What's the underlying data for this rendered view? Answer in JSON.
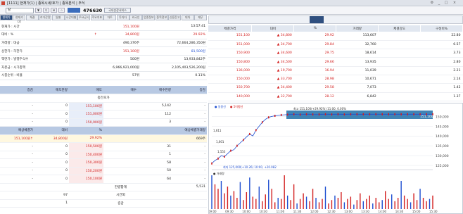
{
  "titlebar": {
    "title": "[1111] 현재가(1) | 종목시세/호가 | 종목분석 | 주식",
    "tabs": "현재가 | 종목시세 | 차트 | 기타"
  },
  "toolbar": {
    "code_value": "탈",
    "price_display": "476630",
    "service_label": "국내상장서비스",
    "btn_labels": [
      "▼",
      "⚲",
      "⊞",
      "☆"
    ]
  },
  "tabs": [
    "현재가(1)",
    "현재가(2)",
    "체결",
    "호가잔량",
    "일별",
    "시간대별",
    "주요공시",
    "주요지표",
    "차트",
    "투자자",
    "외국인",
    "업종정보",
    "종목정보",
    "신용잔고",
    "대차",
    "재무"
  ],
  "info_rows": [
    {
      "label": "현재가 : 시간",
      "v1": "151,100원",
      "v2": "13:57:41"
    },
    {
      "label": "대비 : %",
      "v1": "34,800원",
      "v2": "29.92%",
      "mark": "↑"
    },
    {
      "label": "거래량 : 대금",
      "v1": "490,376주",
      "v2": "72,664,286,350원"
    },
    {
      "label": "상한가 : 하한가",
      "v1": "151,100원",
      "v2": "81,500원"
    },
    {
      "label": "액면가 : 발행주식수",
      "v1": "500원",
      "v2": "13,933,842주"
    },
    {
      "label": "자본금 : 시가총액",
      "v1": "6,966,921,000원",
      "v2": "2,105,403,526,200원"
    },
    {
      "label": "시총순위 : 비율",
      "v1": "57위",
      "v2": "0.11%"
    }
  ],
  "orderbook": {
    "headers": [
      "증감",
      "매도잔량",
      "매도",
      "매수",
      "매수잔량",
      "증감"
    ],
    "middle_label": "중간호가",
    "asks": [
      {
        "dq": "-",
        "qty": "0",
        "price": "151,100원",
        "bq": "5,142",
        "bd": "-"
      },
      {
        "dq": "-",
        "qty": "0",
        "price": "151,000원",
        "bq": "112",
        "bd": "-"
      },
      {
        "dq": "-",
        "qty": "0",
        "price": "150,900원",
        "bq": "3",
        "bd": "-"
      }
    ],
    "expected_headers": [
      "예상체결가",
      "대비",
      "%",
      "예상체결거래량"
    ],
    "expected": {
      "price": "151,100원",
      "mark": "↑",
      "diff": "34,800원",
      "pct": "29.92%",
      "vol": "669주"
    },
    "bids": [
      {
        "dq": "-",
        "qty": "0",
        "price": "150,500원",
        "bq": "31",
        "bd": "-"
      },
      {
        "dq": "-",
        "qty": "0",
        "price": "150,400원",
        "bq": "1",
        "bd": "-"
      },
      {
        "dq": "-",
        "qty": "0",
        "price": "150,300원",
        "bq": "58",
        "bd": "-"
      },
      {
        "dq": "-",
        "qty": "0",
        "price": "150,200원",
        "bq": "50",
        "bd": "-"
      },
      {
        "dq": "-",
        "qty": "0",
        "price": "150,100원",
        "bq": "64",
        "bd": "-"
      }
    ],
    "total_label": "잔량합계",
    "total_value": "5,531",
    "time_label": "시간외",
    "time_value": "97",
    "bottom_label": "증감",
    "bottom_left": "1"
  },
  "trades": {
    "headers": [
      "체결가격",
      "대비",
      "%",
      "거래량",
      "체결강도",
      "구성비%"
    ],
    "rows": [
      {
        "price": "151,100",
        "diff": "34,800",
        "pct": "29.92",
        "vol": "113,607",
        "ratio": "22.80"
      },
      {
        "price": "151,000",
        "diff": "34,700",
        "pct": "29.84",
        "vol": "32,760",
        "ratio": "6.57"
      },
      {
        "price": "150,900",
        "diff": "34,600",
        "pct": "29.75",
        "vol": "18,614",
        "ratio": "3.73"
      },
      {
        "price": "150,800",
        "diff": "34,500",
        "pct": "29.66",
        "vol": "13,935",
        "ratio": "2.80"
      },
      {
        "price": "136,000",
        "diff": "19,700",
        "pct": "16.94",
        "vol": "11,039",
        "ratio": "2.21"
      },
      {
        "price": "150,000",
        "diff": "33,700",
        "pct": "28.98",
        "vol": "10,671",
        "ratio": "2.14"
      },
      {
        "price": "150,700",
        "diff": "34,400",
        "pct": "29.58",
        "vol": "7,073",
        "ratio": "1.42"
      },
      {
        "price": "140,000",
        "diff": "32,700",
        "pct": "28.12",
        "vol": "6,842",
        "ratio": "1.37"
      }
    ]
  },
  "chart_data": {
    "type": "line",
    "legend": [
      "● 일봉선",
      "● 5이평선"
    ],
    "high_label": "최고 151,100(+29.92%) 11:00, 0.00%",
    "low_label": "최저 125,000(+10.26) 10:00, +20.082",
    "last_label": "151,100",
    "volume_label": "● 거래량",
    "yticks": [
      "150,000",
      "145,000",
      "140,000",
      "135,000",
      "130,000",
      "125,000"
    ],
    "xticks": [
      "09:00",
      "09:30",
      "10:00",
      "10:30",
      "11:00",
      "11:30",
      "12:00",
      "12:30",
      "13:00",
      "13:30",
      "14:00",
      "14:30",
      "15:00",
      "15:30"
    ],
    "marks": [
      "1,611",
      "1,601",
      "1,553"
    ],
    "x": [
      0,
      1,
      2,
      3,
      4,
      5,
      6,
      7,
      8,
      9,
      10,
      11,
      12,
      13,
      14,
      15,
      16,
      17,
      18,
      19,
      20,
      21,
      22,
      23,
      24,
      25,
      26,
      27,
      28,
      29,
      30,
      31,
      32,
      33,
      34,
      35,
      36,
      37,
      38,
      39,
      40,
      41,
      42,
      43,
      44,
      45,
      46,
      47,
      48,
      49,
      50,
      51,
      52,
      53,
      54,
      55,
      56,
      57,
      58,
      59,
      60,
      61,
      62,
      63,
      64,
      65,
      66,
      67,
      68,
      69,
      70
    ],
    "price": [
      126000,
      127500,
      128500,
      130000,
      129500,
      131000,
      132500,
      133000,
      135000,
      136500,
      138000,
      139500,
      141000,
      140000,
      143000,
      145000,
      147000,
      148500,
      149500,
      150000,
      150300,
      150500,
      150700,
      150800,
      150900,
      151000,
      151100,
      151000,
      150900,
      151000,
      151100,
      151100,
      151000,
      150900,
      151000,
      151100,
      151100,
      151100,
      151000,
      151100,
      151100,
      151100,
      151000,
      151100,
      151100,
      151100,
      151100,
      151000,
      151100,
      151100,
      151100,
      151100,
      151100,
      151100,
      151100,
      151100,
      151100,
      151100,
      151100,
      151100,
      151100,
      151100,
      151100,
      151100,
      151100,
      151100,
      151100,
      151100,
      151100,
      151100,
      151100
    ],
    "volume": [
      30,
      22,
      18,
      25,
      14,
      20,
      12,
      16,
      10,
      24,
      8,
      15,
      28,
      11,
      9,
      20,
      7,
      13,
      26,
      18,
      6,
      10,
      9,
      30,
      12,
      8,
      22,
      5,
      9,
      14,
      11,
      7,
      18,
      10,
      6,
      9,
      20,
      5,
      8,
      12,
      10,
      15,
      6,
      9,
      11,
      4,
      8,
      14,
      7,
      9,
      12,
      5,
      10,
      6,
      8,
      16,
      9,
      13,
      7,
      10,
      25,
      12,
      9,
      6,
      14,
      8,
      18,
      10,
      7,
      9,
      12
    ],
    "ylim": [
      125000,
      153000
    ]
  },
  "colors": {
    "up": "#d32020",
    "down": "#1f4fd1",
    "header": "#b8c9e3",
    "chart_band": "#1f6fa8"
  }
}
